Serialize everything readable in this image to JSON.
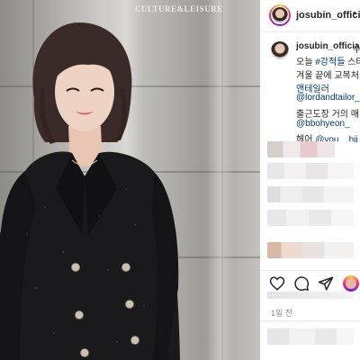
{
  "photo": {
    "watermark": "CULTURE&LEISURE",
    "colors": {
      "jacket": "#1a1a1c",
      "hair": "#3b2b28",
      "skin": "#efd3c2",
      "buttons": "#c9c2b0"
    }
  },
  "post": {
    "username": "josubin_official",
    "header_separator": "•",
    "caption": {
      "username": "josubin_official",
      "after_user": "수",
      "lines": [
        {
          "text": "오늘 #강적들 스타",
          "kind": "mixed"
        },
        {
          "text": "겨울 끝에 교복처",
          "kind": "text"
        },
        {
          "text": "앤테일러",
          "kind": "tag"
        },
        {
          "text": "@lordandtailor_o",
          "kind": "tag"
        },
        {
          "text": "출근도장 거의 매",
          "kind": "text"
        },
        {
          "text": "@bbohyeon_",
          "kind": "tag"
        },
        {
          "text": "헤어 @you__hii",
          "kind": "mixed"
        }
      ],
      "line1": {
        "prefix": "오늘 ",
        "tag": "#강적들",
        "suffix": " 스타"
      },
      "line7": {
        "prefix": "헤어 ",
        "tag": "@you__hii"
      }
    },
    "time_ago": "1일 전",
    "action_icons": [
      "heart-icon",
      "comment-icon",
      "share-icon",
      "story-avatar"
    ],
    "accent_colors": {
      "link": "#00376b",
      "text": "#262626",
      "muted": "#8e8e8e",
      "border": "#efefef"
    }
  }
}
